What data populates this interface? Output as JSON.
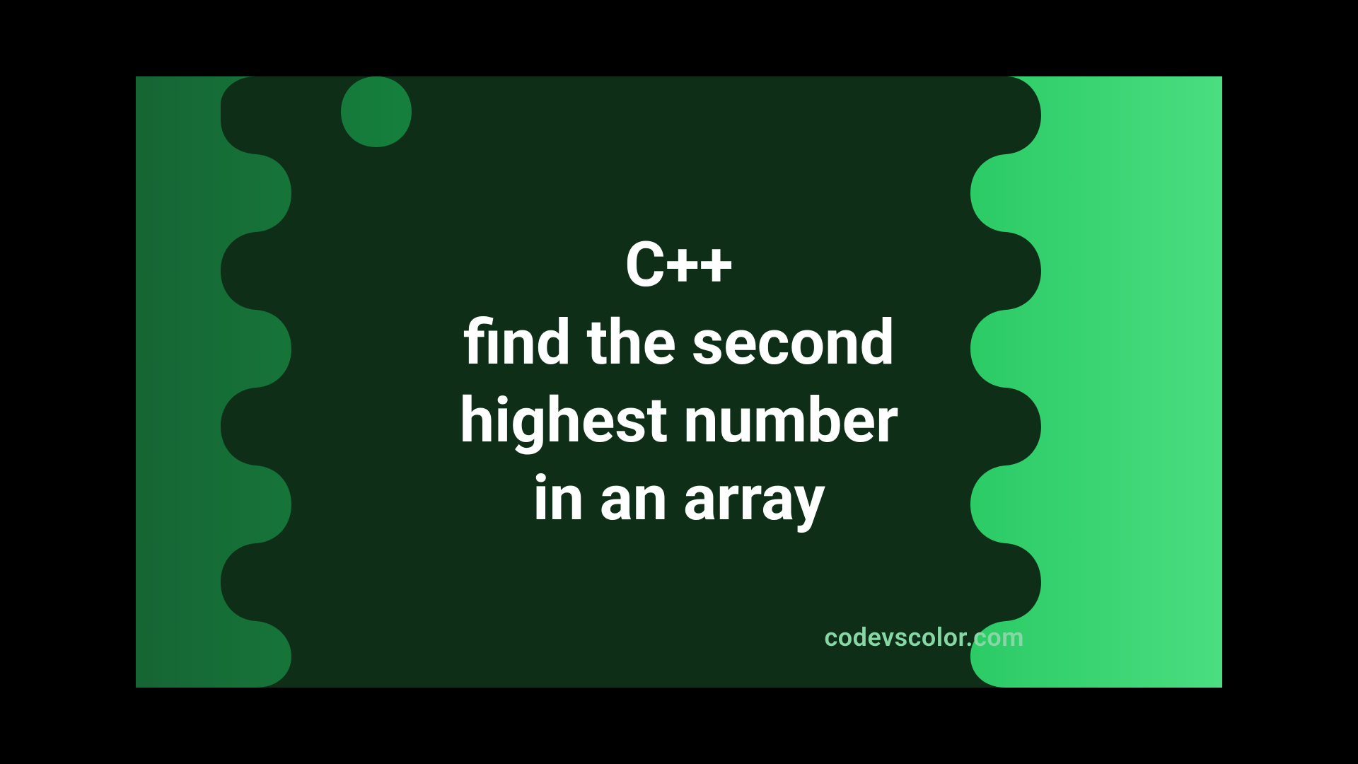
{
  "title": {
    "line1": "C++",
    "line2": "find the second",
    "line3": "highest number",
    "line4": "in an array"
  },
  "watermark": "codevscolor.com",
  "colors": {
    "blob": "#0f2e18",
    "text": "#ffffff",
    "watermark": "#86d7a4",
    "gradient_from": "#166534",
    "gradient_to": "#4ade80",
    "letterbox": "#000000"
  }
}
